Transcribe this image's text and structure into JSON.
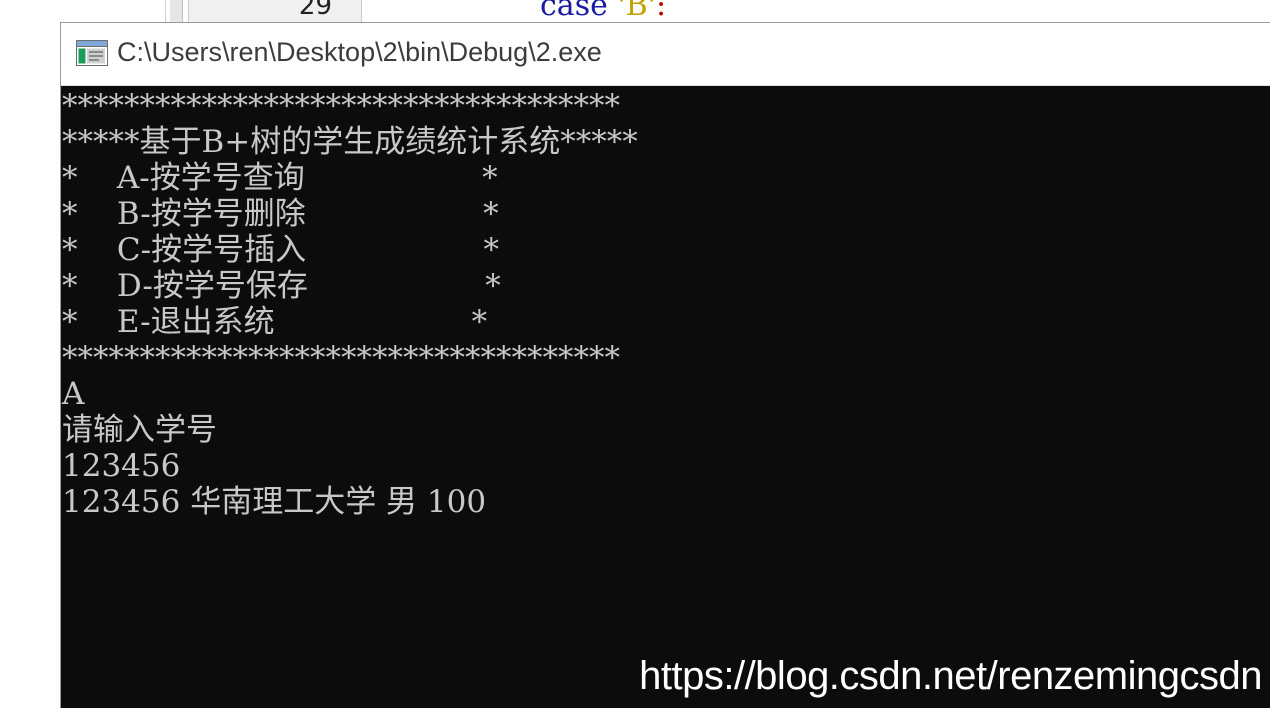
{
  "editor": {
    "line_number": "29",
    "code_keyword": "case",
    "code_string": "'B'",
    "code_punct": ":"
  },
  "window": {
    "title": "C:\\Users\\ren\\Desktop\\2\\bin\\Debug\\2.exe",
    "icon": "console-app-icon"
  },
  "console": {
    "lines": [
      "************************************",
      "*****基于B+树的学生成绩统计系统*****",
      "*    A-按学号查询                  *",
      "*    B-按学号删除                  *",
      "*    C-按学号插入                  *",
      "*    D-按学号保存                  *",
      "*    E-退出系统                    *",
      "************************************",
      "A",
      "请输入学号",
      "123456",
      "123456 华南理工大学 男 100"
    ]
  },
  "watermark": "https://blog.csdn.net/renzemingcsdn",
  "colors": {
    "console_background": "#0c0c0c",
    "console_text": "#c8c8c8",
    "title_bar_background": "#ffffff",
    "title_text": "#3c3c3c"
  }
}
